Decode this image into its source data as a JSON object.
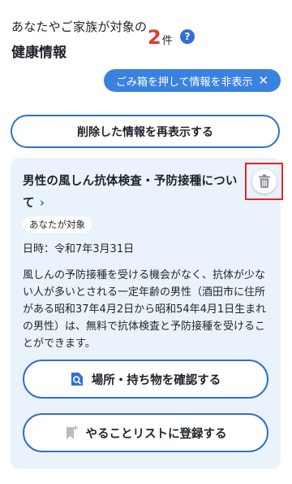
{
  "header": {
    "line1": "あなたやご家族が対象の",
    "line2": "健康情報",
    "count": "2",
    "count_unit": "件",
    "help_symbol": "?"
  },
  "hide_chip": {
    "label": "ごみ箱を押して情報を非表示",
    "close_symbol": "✕"
  },
  "redisplay_button": {
    "label": "削除した情報を再表示する"
  },
  "card": {
    "title": "男性の風しん抗体検査・予防接種について",
    "chevron": "›",
    "tag": "あなたが対象",
    "date": "日時：令和7年3月31日",
    "description": "風しんの予防接種を受ける機会がなく、抗体が少ない人が多いとされる一定年齢の男性（酒田市に住所がある昭和37年4月2日から昭和54年4月1日生まれの男性）は、無料で抗体検査と予防接種を受けることができます。",
    "location_button": "場所・持ち物を確認する",
    "todo_button": "やることリストに登録する"
  },
  "colors": {
    "accent": "#2f6fd6",
    "chip": "#3a82e0",
    "count": "#e03a2f",
    "card_bg": "#eaf3fb",
    "highlight_frame": "#e0262a"
  },
  "icons": {
    "help": "help-icon",
    "close": "close-icon",
    "trash": "trash-icon",
    "chevron": "chevron-right-icon",
    "search_doc": "search-document-icon",
    "bookmark_add": "bookmark-add-icon"
  }
}
